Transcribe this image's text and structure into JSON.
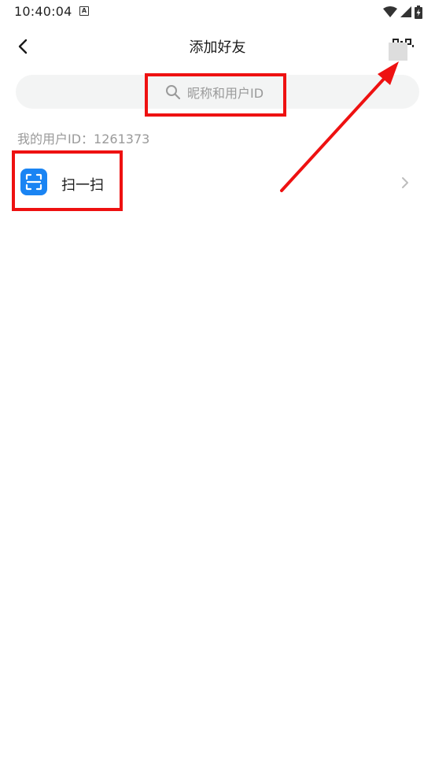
{
  "status_bar": {
    "time": "10:40:04",
    "notification_icon": "a-letter-icon",
    "wifi_icon": "wifi-icon",
    "signal_icon": "signal-icon",
    "battery_icon": "battery-charging-icon"
  },
  "header": {
    "title": "添加好友",
    "back_icon": "chevron-left-icon",
    "qr_icon": "qr-code-icon"
  },
  "search": {
    "placeholder": "昵称和用户ID",
    "icon": "search-icon"
  },
  "my_user_id": "我的用户ID：1261373",
  "scan": {
    "label": "扫一扫",
    "icon": "scan-icon",
    "icon_color": "#1a84f3",
    "chevron_icon": "chevron-right-icon"
  },
  "annotations": {
    "color": "#ee1111"
  }
}
